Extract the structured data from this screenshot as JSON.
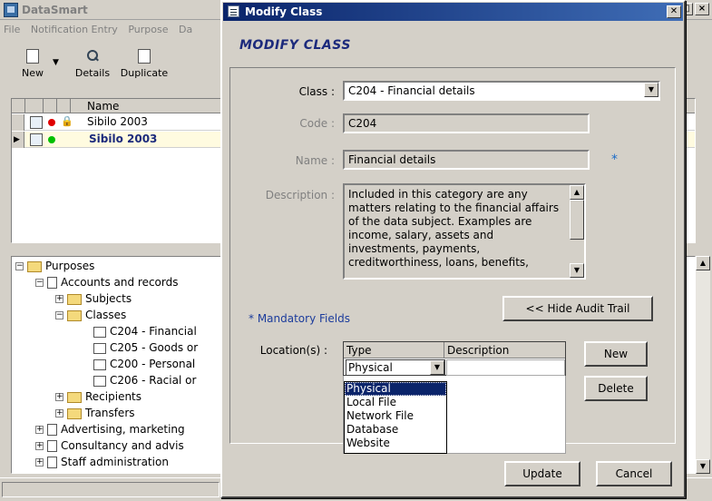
{
  "main_window": {
    "title": "DataSmart",
    "menu": [
      "File",
      "Notification Entry",
      "Purpose",
      "Da"
    ],
    "toolbar": [
      {
        "label": "New",
        "icon": "new-doc-icon"
      },
      {
        "label": "Details",
        "icon": "magnifier-icon"
      },
      {
        "label": "Duplicate",
        "icon": "duplicate-icon"
      }
    ],
    "grid": {
      "column_name": "Name",
      "rows": [
        {
          "name": "Sibilo 2003",
          "status_color": "#e00000",
          "bold": false
        },
        {
          "name": "Sibilo 2003",
          "status_color": "#00c000",
          "bold": true
        }
      ]
    },
    "tree": [
      {
        "label": "Purposes",
        "indent": 0,
        "kind": "root",
        "expander": "−"
      },
      {
        "label": "Accounts and records",
        "indent": 1,
        "kind": "doc",
        "expander": "−"
      },
      {
        "label": "Subjects",
        "indent": 2,
        "kind": "folder",
        "expander": "+"
      },
      {
        "label": "Classes",
        "indent": 2,
        "kind": "folder",
        "expander": "−"
      },
      {
        "label": "C204 - Financial",
        "indent": 3,
        "kind": "item",
        "expander": ""
      },
      {
        "label": "C205 - Goods or",
        "indent": 3,
        "kind": "item",
        "expander": ""
      },
      {
        "label": "C200 - Personal",
        "indent": 3,
        "kind": "item",
        "expander": ""
      },
      {
        "label": "C206 - Racial or",
        "indent": 3,
        "kind": "item",
        "expander": ""
      },
      {
        "label": "Recipients",
        "indent": 2,
        "kind": "folder",
        "expander": "+"
      },
      {
        "label": "Transfers",
        "indent": 2,
        "kind": "folder",
        "expander": "+"
      },
      {
        "label": "Advertising, marketing",
        "indent": 1,
        "kind": "doc",
        "expander": "+"
      },
      {
        "label": "Consultancy and advis",
        "indent": 1,
        "kind": "doc",
        "expander": "+"
      },
      {
        "label": "Staff administration",
        "indent": 1,
        "kind": "doc",
        "expander": "+"
      }
    ]
  },
  "dialog": {
    "title": "Modify Class",
    "close_label": "✕",
    "heading": "MODIFY CLASS",
    "class_label": "Class :",
    "class_value": "C204 - Financial details",
    "code_label": "Code :",
    "code_value": "C204",
    "name_label": "Name :",
    "name_value": "Financial details",
    "mandatory_star": "*",
    "description_label": "Description :",
    "description_value": "Included in this category are any matters relating to the financial affairs of the data subject. Examples are income, salary, assets and investments, payments, creditworthiness, loans, benefits,",
    "hide_audit_label": "<< Hide Audit Trail",
    "mandatory_note": "* Mandatory Fields",
    "location_label": "Location(s) :",
    "location_columns": [
      "Type",
      "Description"
    ],
    "type_value": "Physical",
    "type_options": [
      "Physical",
      "Local File",
      "Network File",
      "Database",
      "Website"
    ],
    "new_label": "New",
    "delete_label": "Delete",
    "update_label": "Update",
    "cancel_label": "Cancel"
  }
}
